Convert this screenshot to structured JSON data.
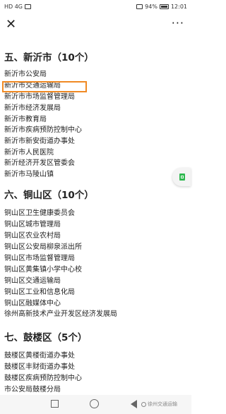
{
  "status": {
    "left_text": "HD 4G",
    "battery": "94%",
    "time": "12:01"
  },
  "nav": {
    "close": "✕",
    "more": "···"
  },
  "sections": [
    {
      "heading": "五、新沂市（10个）",
      "items": [
        "新沂市公安局",
        "新沂市交通运输局",
        "新沂市市场监督管理局",
        "新沂市经济发展局",
        "新沂市教育局",
        "新沂市疾病预防控制中心",
        "新沂市新安街道办事处",
        "新沂市人民医院",
        "新沂经济开发区管委会",
        "新沂市马陵山镇"
      ]
    },
    {
      "heading": "六、铜山区（10个）",
      "items": [
        "铜山区卫生健康委员会",
        "铜山区城市管理局",
        "铜山区农业农村局",
        "铜山区公安局柳泉派出所",
        "铜山区市场监督管理局",
        "铜山区黄集镇小学中心校",
        "铜山区交通运输局",
        "铜山区工业和信息化局",
        "铜山区融媒体中心",
        "徐州高新技术产业开发区经济发展局"
      ]
    },
    {
      "heading": "七、鼓楼区（5个）",
      "items": [
        "鼓楼区黄楼街道办事处",
        "鼓楼区丰财街道办事处",
        "鼓楼区疾病预防控制中心",
        "市公安局鼓楼分局"
      ]
    }
  ],
  "watermark": "徐州交通运输",
  "highlight_color": "#f08a24"
}
